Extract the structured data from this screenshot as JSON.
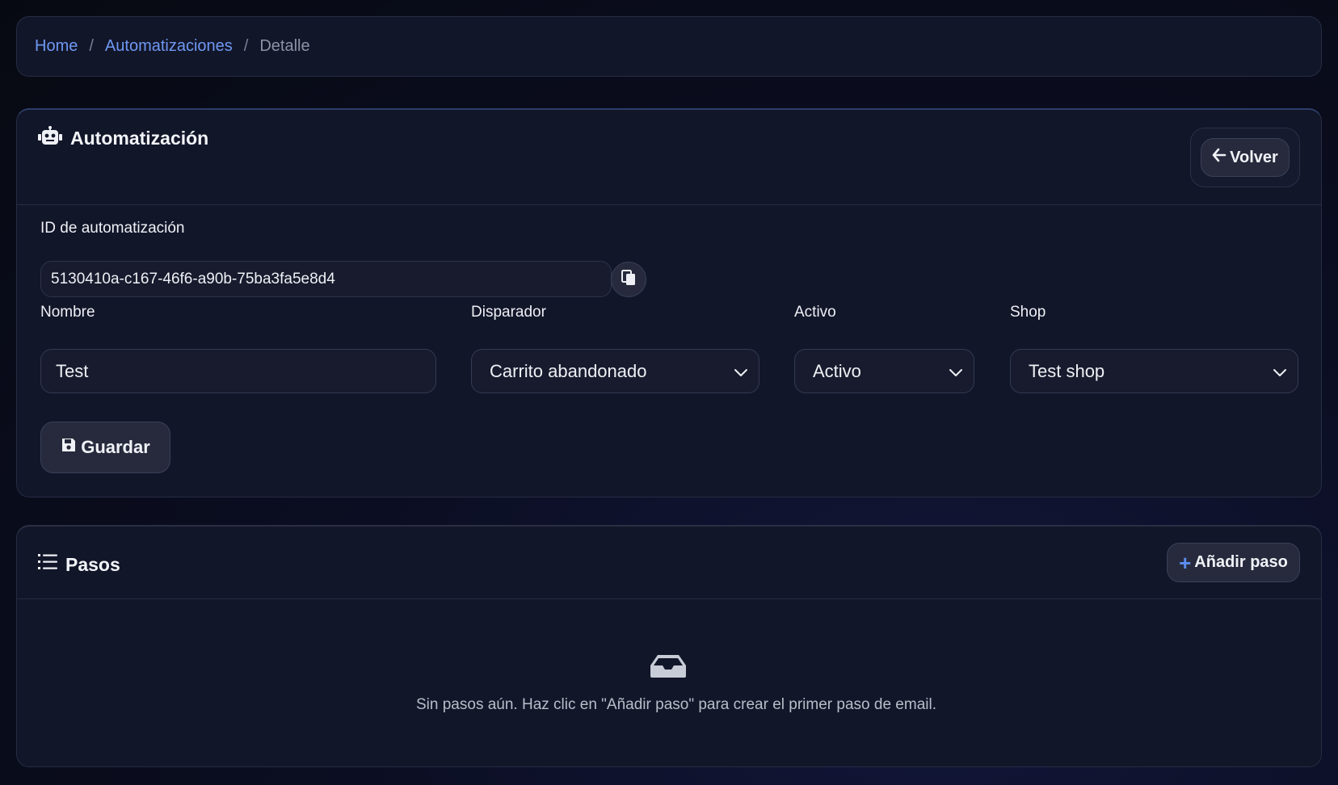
{
  "breadcrumb": {
    "items": [
      {
        "label": "Home"
      },
      {
        "label": "Automatizaciones"
      },
      {
        "label": "Detalle"
      }
    ],
    "separator": "/"
  },
  "automation": {
    "title": "Automatización",
    "title_icon": "robot-icon",
    "back_label": "Volver",
    "back_icon": "arrow-left-icon",
    "id_label": "ID de automatización",
    "id_value": "5130410a-c167-46f6-a90b-75ba3fa5e8d4",
    "copy_icon": "copy-icon",
    "name_label": "Nombre",
    "name_value": "Test",
    "trigger_label": "Disparador",
    "trigger_value": "Carrito abandonado",
    "active_label": "Activo",
    "active_value": "Activo",
    "shop_label": "Shop",
    "shop_value": "Test shop",
    "save_label": "Guardar",
    "save_icon": "floppy-disk-icon"
  },
  "steps": {
    "title": "Pasos",
    "title_icon": "list-icon",
    "add_label": "Añadir paso",
    "add_icon": "plus-icon",
    "empty_icon": "inbox-icon",
    "empty_message": "Sin pasos aún. Haz clic en \"Añadir paso\" para crear el primer paso de email."
  },
  "colors": {
    "accent": "#6f98f2",
    "card_bg": "#121629",
    "page_bg": "#0b0e22"
  }
}
